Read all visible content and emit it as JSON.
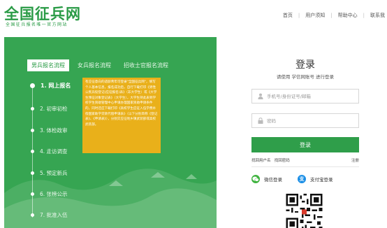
{
  "header": {
    "logo_title": "全国征兵网",
    "logo_subtitle": "全国征兵报名唯一官方网站",
    "nav": [
      "首页",
      "用户须知",
      "帮助中心",
      "联系我"
    ]
  },
  "flow": {
    "tabs": [
      "男兵报名流程",
      "女兵报名流程",
      "招收士官报名流程"
    ],
    "active_tab": 0,
    "steps": [
      "1. 网上报名",
      "2. 初审初检",
      "3. 体检政审",
      "4. 走访调查",
      "5. 预定新兵",
      "6. 张榜公示",
      "7. 批准入伍"
    ],
    "active_step": 0,
    "step_description": "有应征意向的适龄青年可登录\"全国征兵网\"，填写个人基本信息，报名成功后，自行下载打印《男性公民兵役登记(应征报名)表》（非大学生）或《大学生预征对象登记表》（大学生），大学生持此表到学校学生资助管理中心申请办理国家资助申请条件的，同时还应下载打印《高校学生应征入伍学费补偿国家助学贷款代偿申请表》（以下分别简称《登记表》、《申请表》），分别交应征地乡镇武装部或高校武装部。"
  },
  "login": {
    "title": "登录",
    "subtitle": "请使用 学信网账号 进行登录",
    "username_placeholder": "手机号/身份证号/邮箱",
    "password_placeholder": "密码",
    "submit": "登录",
    "find_username": "找回用户名",
    "find_password": "找回密码",
    "register": "注册",
    "wechat_login": "微信登录",
    "alipay_login": "支付宝登录"
  },
  "colors": {
    "brand_green": "#2a9b46",
    "panel_green": "#36a552",
    "desc_yellow": "#e9b01a",
    "wechat_green": "#3fb33f",
    "alipay_blue": "#1a8ee6"
  }
}
